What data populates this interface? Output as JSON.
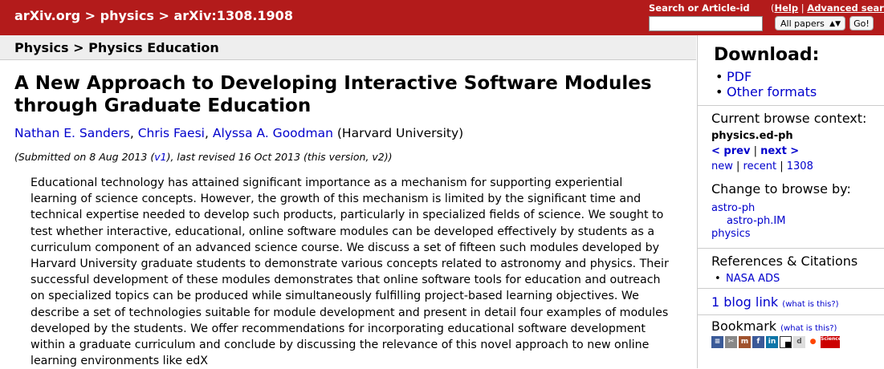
{
  "header": {
    "crumbs": [
      "arXiv.org",
      "physics",
      "arXiv:1308.1908"
    ],
    "crumb_sep": ">",
    "search_label": "Search or Article-id",
    "help_open": "(",
    "help_label": "Help",
    "help_sep": "|",
    "advanced_label": "Advanced search",
    "help_close": ")",
    "select_value": "All papers",
    "go_label": "Go!",
    "brand_color": "#b31b1b"
  },
  "subheader": {
    "text": "Physics > Physics Education"
  },
  "paper": {
    "title": "A New Approach to Developing Interactive Software Modules through Graduate Education",
    "authors": [
      "Nathan E. Sanders",
      "Chris Faesi",
      "Alyssa A. Goodman"
    ],
    "affiliation": "(Harvard University)",
    "dateline_pre": "(Submitted on 8 Aug 2013 (",
    "dateline_v1": "v1",
    "dateline_post": "), last revised 16 Oct 2013 (this version, v2))",
    "abstract": "Educational technology has attained significant importance as a mechanism for supporting experiential learning of science concepts. However, the growth of this mechanism is limited by the significant time and technical expertise needed to develop such products, particularly in specialized fields of science. We sought to test whether interactive, educational, online software modules can be developed effectively by students as a curriculum component of an advanced science course. We discuss a set of fifteen such modules developed by Harvard University graduate students to demonstrate various concepts related to astronomy and physics. Their successful development of these modules demonstrates that online software tools for education and outreach on specialized topics can be produced while simultaneously fulfilling project-based learning objectives. We describe a set of technologies suitable for module development and present in detail four examples of modules developed by the students. We offer recommendations for incorporating educational software development within a graduate curriculum and conclude by discussing the relevance of this novel approach to new online learning environments like edX"
  },
  "sidebar": {
    "download_heading": "Download:",
    "download_items": [
      "PDF",
      "Other formats"
    ],
    "context_heading": "Current browse context:",
    "context_value": "physics.ed-ph",
    "prev_label": "< prev",
    "next_label": "next >",
    "nav_sep": "|",
    "new_label": "new",
    "recent_label": "recent",
    "month_label": "1308",
    "change_heading": "Change to browse by:",
    "browse_items": [
      "astro-ph",
      "astro-ph.IM",
      "physics"
    ],
    "refs_heading": "References & Citations",
    "refs_items": [
      "NASA ADS"
    ],
    "blog_label": "1 blog link",
    "whatis_label": "(what is this?)",
    "bookmark_heading": "Bookmark",
    "bookmark_icons": [
      "bibsonomy-icon",
      "citeulike-icon",
      "mendeley-icon",
      "facebook-icon",
      "linkedin-icon",
      "delicious-icon",
      "digg-icon",
      "reddit-icon",
      "sciencewise-icon"
    ],
    "sciencewise_text": "Science WISE"
  }
}
